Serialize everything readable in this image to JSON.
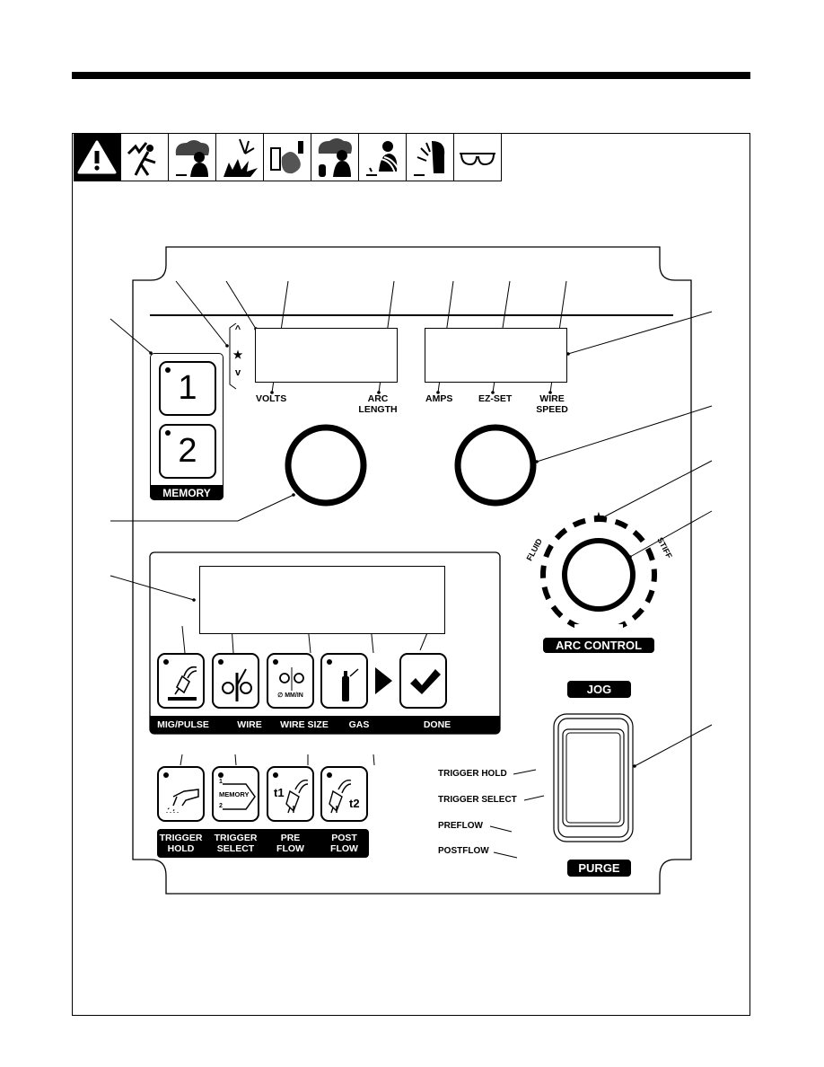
{
  "warning_icons": [
    "warning-triangle-icon",
    "electric-shock-icon",
    "fumes-icon",
    "arc-rays-explosion-icon",
    "fire-hazard-icon",
    "gas-cylinder-fumes-icon",
    "hot-parts-icon",
    "noise-hazard-icon",
    "safety-glasses-icon"
  ],
  "indicators": {
    "up": "^",
    "star": "★",
    "down": "v"
  },
  "meter_labels": {
    "volts": "VOLTS",
    "arc_length": [
      "ARC",
      "LENGTH"
    ],
    "amps": "AMPS",
    "ez_set": "EZ-SET",
    "wire_speed": [
      "WIRE",
      "SPEED"
    ]
  },
  "memory": {
    "buttons": [
      "1",
      "2"
    ],
    "label": "MEMORY"
  },
  "arc_control": {
    "label": "ARC CONTROL",
    "fluid": "FLUID",
    "stiff": "STIFF",
    "star": "★"
  },
  "setup_buttons": [
    {
      "label": "MIG/PULSE",
      "icon": "mig-gun-icon"
    },
    {
      "label": "WIRE",
      "icon": "wire-spool-icon"
    },
    {
      "label": "WIRE SIZE",
      "icon": "wire-size-icon",
      "sub": "∅ MM/IN"
    },
    {
      "label": "GAS",
      "icon": "gas-cylinder-icon"
    },
    {
      "label": "DONE",
      "icon": "checkmark-icon"
    }
  ],
  "trigger_buttons": [
    {
      "label": [
        "TRIGGER",
        "HOLD"
      ],
      "icon": "trigger-hold-icon"
    },
    {
      "label": [
        "TRIGGER",
        "SELECT"
      ],
      "icon": "trigger-select-icon",
      "sub": [
        "1",
        "MEMORY",
        "2"
      ]
    },
    {
      "label": [
        "PRE",
        "FLOW"
      ],
      "icon": "preflow-icon",
      "sub": "t1"
    },
    {
      "label": [
        "POST",
        "FLOW"
      ],
      "icon": "postflow-icon",
      "sub": "t2"
    }
  ],
  "side_labels": [
    "TRIGGER HOLD",
    "TRIGGER SELECT",
    "PREFLOW",
    "POSTFLOW"
  ],
  "jog_purge": {
    "jog": "JOG",
    "purge": "PURGE"
  }
}
